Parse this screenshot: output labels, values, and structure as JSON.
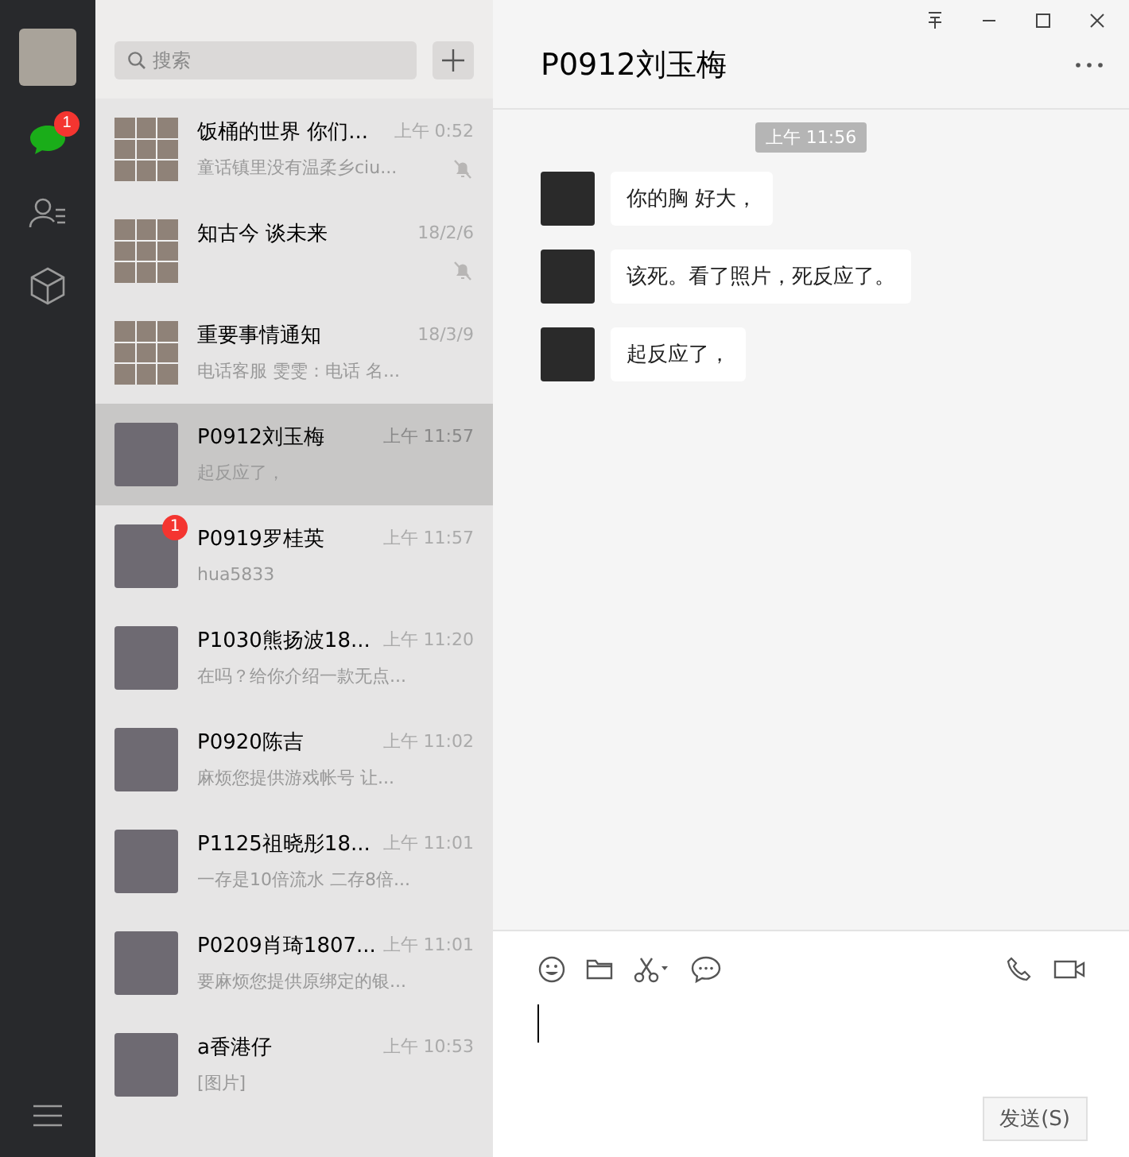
{
  "sidebar": {
    "nav": [
      {
        "kind": "chats",
        "selected": true,
        "badge": "1"
      },
      {
        "kind": "contacts",
        "selected": false
      },
      {
        "kind": "favorites",
        "selected": false
      }
    ]
  },
  "search": {
    "placeholder": "搜索"
  },
  "chats": [
    {
      "name": "饭桶的世界 你们...",
      "time": "上午 0:52",
      "preview": "童话镇里没有温柔乡ciu...",
      "muted": true,
      "selected": false,
      "kind": "group"
    },
    {
      "name": "知古今 谈未来",
      "time": "18/2/6",
      "muted": true,
      "selected": false,
      "kind": "group"
    },
    {
      "name": "重要事情通知",
      "time": "18/3/9",
      "preview": "电话客服 雯雯：电话  名...",
      "muted": false,
      "selected": false,
      "kind": "group"
    },
    {
      "name": "P0912刘玉梅",
      "time": "上午 11:57",
      "preview": "起反应了，",
      "muted": false,
      "selected": true,
      "kind": "person"
    },
    {
      "name": "P0919罗桂英",
      "time": "上午 11:57",
      "preview": "hua5833",
      "muted": false,
      "selected": false,
      "kind": "person",
      "badge": "1"
    },
    {
      "name": "P1030熊扬波18...",
      "time": "上午 11:20",
      "preview": "在吗？给你介绍一款无点...",
      "muted": false,
      "selected": false,
      "kind": "person"
    },
    {
      "name": "P0920陈吉",
      "time": "上午 11:02",
      "preview": "麻烦您提供游戏帐号 让...",
      "muted": false,
      "selected": false,
      "kind": "person"
    },
    {
      "name": "P1125祖晓彤18...",
      "time": "上午 11:01",
      "preview": "一存是10倍流水 二存8倍...",
      "muted": false,
      "selected": false,
      "kind": "person"
    },
    {
      "name": "P0209肖琦1807...",
      "time": "上午 11:01",
      "preview": "要麻烦您提供原绑定的银...",
      "muted": false,
      "selected": false,
      "kind": "person"
    },
    {
      "name": "a香港仔",
      "time": "上午 10:53",
      "preview": "[图片]",
      "muted": false,
      "selected": false,
      "kind": "person"
    }
  ],
  "conversation": {
    "title": "P0912刘玉梅",
    "timestamp": "上午 11:56",
    "messages": [
      {
        "text": "你的胸 好大，"
      },
      {
        "text": "该死。看了照片，死反应了。"
      },
      {
        "text": "起反应了，"
      }
    ]
  },
  "composer": {
    "tools": [
      {
        "kind": "emoji"
      },
      {
        "kind": "folder"
      },
      {
        "kind": "scissors"
      },
      {
        "kind": "chat"
      }
    ],
    "calls": [
      {
        "kind": "phone"
      },
      {
        "kind": "video"
      }
    ],
    "send": "发送(S)"
  }
}
